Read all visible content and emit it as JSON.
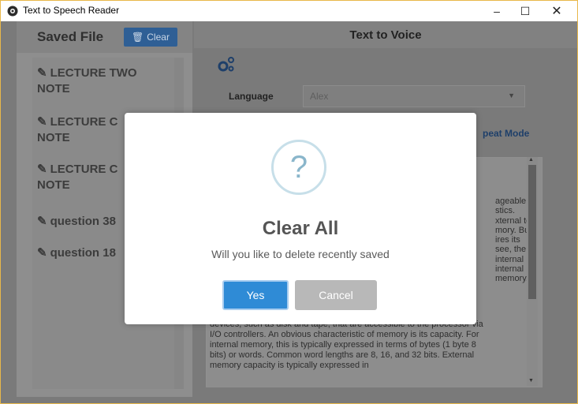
{
  "window": {
    "title": "Text to Speech Reader",
    "minimize_glyph": "–",
    "maximize_glyph": "☐",
    "close_glyph": "✕"
  },
  "sidebar": {
    "title": "Saved File",
    "clear_label": "Clear",
    "items": [
      {
        "line1": "LECTURE TWO",
        "line2": "NOTE"
      },
      {
        "line1": "LECTURE C",
        "line2": "NOTE"
      },
      {
        "line1": "LECTURE C",
        "line2": "NOTE"
      },
      {
        "line1": "question 38",
        "line2": ""
      },
      {
        "line1": "question 18",
        "line2": ""
      }
    ]
  },
  "main": {
    "title": "Text to Voice",
    "language_label": "Language",
    "language_value": "Alex",
    "repeat_mode_label": "peat Mode",
    "text_right_lines": [
      "ageable n",
      "stics.",
      "xternal to",
      "mory. But",
      "ires its",
      "see, the",
      "internal",
      "internal",
      "memory."
    ],
    "text_bottom_lines": [
      "devices, such as disk and tape, that are accessible to the processor via",
      "I/O controllers. An obvious characteristic of memory is its capacity. For",
      "internal memory, this is typically expressed in terms of bytes (1 byte 8",
      "bits) or words. Common word lengths are 8, 16, and 32 bits. External",
      "memory capacity is typically expressed in"
    ]
  },
  "dialog": {
    "icon_glyph": "?",
    "title": "Clear All",
    "message": "Will you like to delete recently saved",
    "yes_label": "Yes",
    "cancel_label": "Cancel"
  },
  "colors": {
    "overlay": "#7a7a7a",
    "accent": "#2f8bd6",
    "clear_button": "#2f5f95"
  }
}
